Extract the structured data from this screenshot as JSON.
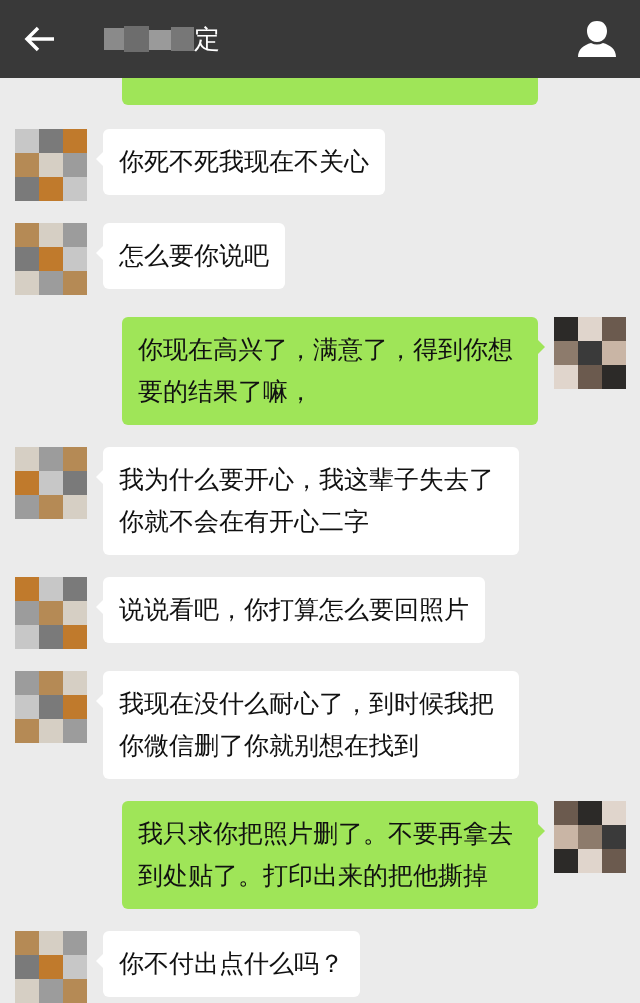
{
  "header": {
    "title": "定"
  },
  "messages": [
    {
      "kind": "stub"
    },
    {
      "kind": "incoming",
      "text": "你死不死我现在不关心"
    },
    {
      "kind": "incoming",
      "text": "怎么要你说吧"
    },
    {
      "kind": "outgoing",
      "text": "你现在高兴了，满意了，得到你想要的结果了嘛，"
    },
    {
      "kind": "incoming",
      "text": "我为什么要开心，我这辈子失去了你就不会在有开心二字"
    },
    {
      "kind": "incoming",
      "text": "说说看吧，你打算怎么要回照片"
    },
    {
      "kind": "incoming",
      "text": "我现在没什么耐心了，到时候我把你微信删了你就别想在找到"
    },
    {
      "kind": "outgoing",
      "text": "我只求你把照片删了。不要再拿去到处贴了。打印出来的把他撕掉"
    },
    {
      "kind": "incoming",
      "text": "你不付出点什么吗？"
    }
  ]
}
